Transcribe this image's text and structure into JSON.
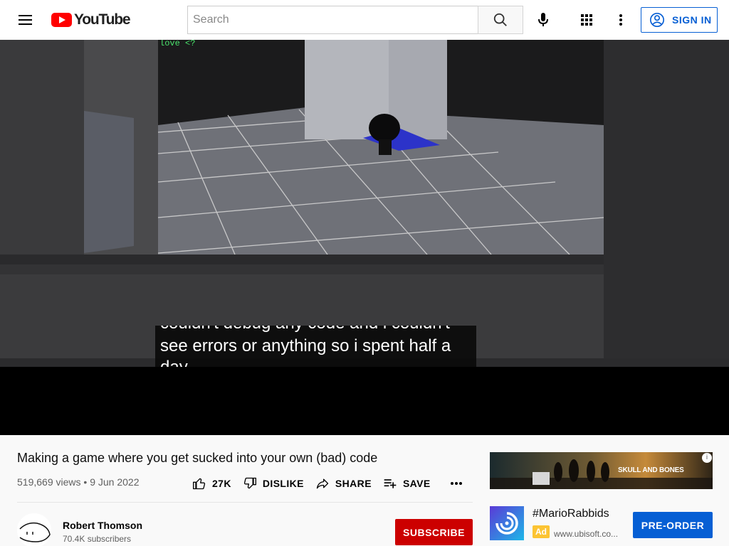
{
  "header": {
    "logo_text": "YouTube",
    "search_placeholder": "Search",
    "sign_in_label": "SIGN IN",
    "icons": [
      "menu-icon",
      "youtube-logo",
      "search-icon",
      "mic-icon",
      "apps-grid-icon",
      "more-vert-icon",
      "account-icon"
    ]
  },
  "player": {
    "caption_line_top": "couldn't debug any code and i couldn't",
    "caption_line_mid": "see errors or anything so i spent half a",
    "caption_line_bottom": "day"
  },
  "video": {
    "title": "Making a game where you get sucked into your own (bad) code",
    "views": "519,669 views",
    "separator": "•",
    "date": "9 Jun 2022",
    "actions": {
      "like": "27K",
      "dislike": "DISLIKE",
      "share": "SHARE",
      "save": "SAVE"
    }
  },
  "channel": {
    "name": "Robert Thomson",
    "subscribers": "70.4K subscribers",
    "subscribe_label": "SUBSCRIBE"
  },
  "ad": {
    "title": "#MarioRabbids",
    "badge": "Ad",
    "url": "www.ubisoft.co...",
    "cta": "PRE-ORDER",
    "banner_text": "SKULL AND BONES",
    "info_icon": "i"
  },
  "colors": {
    "brand_red": "#ff0000",
    "subscribe_red": "#cc0000",
    "link_blue": "#065fd4"
  }
}
